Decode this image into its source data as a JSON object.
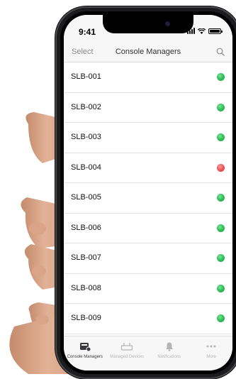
{
  "status_bar": {
    "time": "9:41"
  },
  "nav": {
    "left_label": "Select",
    "title": "Console Managers",
    "search_icon": "search-icon"
  },
  "devices": [
    {
      "name": "SLB-001",
      "status": "online"
    },
    {
      "name": "SLB-002",
      "status": "online"
    },
    {
      "name": "SLB-003",
      "status": "online"
    },
    {
      "name": "SLB-004",
      "status": "offline"
    },
    {
      "name": "SLB-005",
      "status": "online"
    },
    {
      "name": "SLB-006",
      "status": "online"
    },
    {
      "name": "SLB-007",
      "status": "online"
    },
    {
      "name": "SLB-008",
      "status": "online"
    },
    {
      "name": "SLB-009",
      "status": "online"
    }
  ],
  "tabs": [
    {
      "label": "Console Managers",
      "icon": "console-manager-icon",
      "active": true
    },
    {
      "label": "Managed Devices",
      "icon": "managed-devices-icon",
      "active": false
    },
    {
      "label": "Notifications",
      "icon": "bell-icon",
      "active": false
    },
    {
      "label": "More",
      "icon": "more-icon",
      "active": false
    }
  ],
  "colors": {
    "online": "#32c35b",
    "offline": "#f05a5a"
  }
}
